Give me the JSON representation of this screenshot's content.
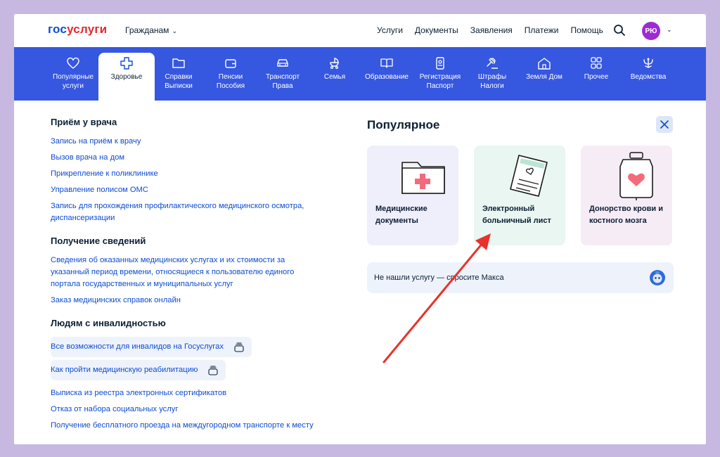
{
  "header": {
    "logo_part1": "гос",
    "logo_part2": "услуги",
    "role": "Гражданам",
    "nav": [
      "Услуги",
      "Документы",
      "Заявления",
      "Платежи",
      "Помощь"
    ],
    "avatar_initials": "РЮ"
  },
  "categories": [
    {
      "label": "Популярные услуги",
      "icon": "heart-icon"
    },
    {
      "label": "Здоровье",
      "icon": "medical-cross-icon",
      "active": true
    },
    {
      "label": "Справки Выписки",
      "icon": "folder-icon"
    },
    {
      "label": "Пенсии Пособия",
      "icon": "wallet-icon"
    },
    {
      "label": "Транспорт Права",
      "icon": "car-icon"
    },
    {
      "label": "Семья",
      "icon": "stroller-icon"
    },
    {
      "label": "Образование",
      "icon": "book-icon"
    },
    {
      "label": "Регистрация Паспорт",
      "icon": "passport-icon"
    },
    {
      "label": "Штрафы Налоги",
      "icon": "gavel-icon"
    },
    {
      "label": "Земля Дом",
      "icon": "house-icon"
    },
    {
      "label": "Прочее",
      "icon": "grid-icon"
    },
    {
      "label": "Ведомства",
      "icon": "emblem-icon"
    }
  ],
  "sections": {
    "doctor": {
      "title": "Приём у врача",
      "links": [
        "Запись на приём к врачу",
        "Вызов врача на дом",
        "Прикрепление к поликлинике",
        "Управление полисом ОМС",
        "Запись для прохождения профилактического медицинского осмотра, диспансеризации"
      ]
    },
    "info": {
      "title": "Получение сведений",
      "links": [
        "Сведения об оказанных медицинских услугах и их стоимости за указанный период времени, относящиеся к пользователю единого портала государственных и муниципальных услуг",
        "Заказ медицинских справок онлайн"
      ]
    },
    "disability": {
      "title": "Людям с инвалидностью",
      "pills": [
        "Все возможности для инвалидов на Госуслугах",
        "Как пройти медицинскую реабилитацию"
      ],
      "links": [
        "Выписка из реестра электронных сертификатов",
        "Отказ от набора социальных услуг",
        "Получение бесплатного проезда на междугородном транспорте к месту"
      ]
    }
  },
  "popular": {
    "title": "Популярное",
    "cards": [
      {
        "title": "Медицинские документы",
        "icon": "medical-folder-icon",
        "color": "#efeefb"
      },
      {
        "title": "Электронный больничный лист",
        "icon": "sick-leave-icon",
        "color": "#e9f6f1"
      },
      {
        "title": "Донорство крови и костного мозга",
        "icon": "blood-bag-icon",
        "color": "#f6ecf6"
      }
    ],
    "ask": "Не нашли услугу — спросите Макса"
  },
  "colors": {
    "brand_blue": "#0d4cd3",
    "brand_red": "#e5282d",
    "category_bar": "#3657e0",
    "annotation_arrow": "#e8322b"
  }
}
